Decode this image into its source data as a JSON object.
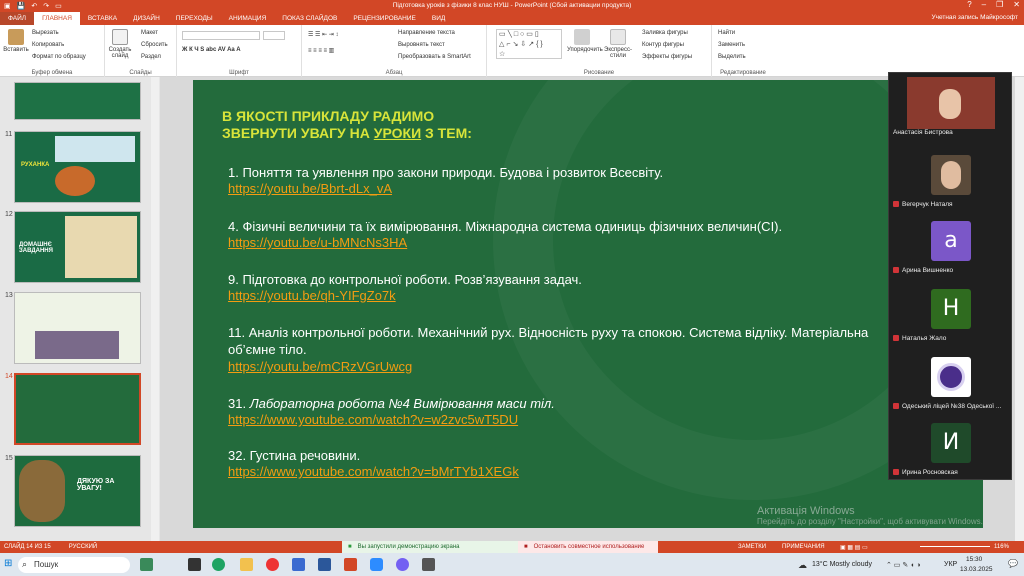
{
  "window": {
    "title": "Підготовка уроків з фізики 8 клас НУШ - PowerPoint (Сбой активации продукта)",
    "account": "Учетная запись Майкрософт"
  },
  "tabs": [
    "ФАЙЛ",
    "ГЛАВНАЯ",
    "ВСТАВКА",
    "ДИЗАЙН",
    "ПЕРЕХОДЫ",
    "АНИМАЦИЯ",
    "ПОКАЗ СЛАЙДОВ",
    "РЕЦЕНЗИРОВАНИЕ",
    "ВИД"
  ],
  "ribbon": {
    "paste": "Вставить",
    "cut": "Вырезать",
    "copy": "Копировать",
    "format": "Формат по образцу",
    "clipboard": "Буфер обмена",
    "new_slide": "Создать слайд",
    "layout": "Макет",
    "reset": "Сбросить",
    "section": "Раздел",
    "slides": "Слайды",
    "font": "Шрифт",
    "paragraph": "Абзац",
    "text_dir": "Направление текста",
    "align_text": "Выровнять текст",
    "smartart": "Преобразовать в SmartArt",
    "arrange": "Упорядочить",
    "quick_styles": "Экспресс-стили",
    "fill": "Заливка фигуры",
    "outline": "Контур фигуры",
    "effects": "Эффекты фигуры",
    "drawing": "Рисование",
    "find": "Найти",
    "replace": "Заменить",
    "select": "Выделить",
    "editing": "Редактирование"
  },
  "thumbnails": [
    {
      "num": "11",
      "title": "РУХАНКА"
    },
    {
      "num": "12",
      "title": "ДОМАШНЄ ЗАВДАННЯ"
    },
    {
      "num": "13",
      "title": ""
    },
    {
      "num": "14",
      "title": ""
    },
    {
      "num": "15",
      "title": "ДЯКУЮ ЗА УВАГУ!"
    }
  ],
  "slide": {
    "heading_line1": "В ЯКОСТІ ПРИКЛАДУ РАДИМО",
    "heading_pre": "ЗВЕРНУТИ УВАГУ НА ",
    "heading_under": "УРОКИ",
    "heading_post": " З ТЕМ:",
    "items": [
      {
        "text": "1.   Поняття та уявлення про закони природи. Будова і розвиток Всесвіту.",
        "link": "https://youtu.be/Bbrt-dLx_vA"
      },
      {
        "text": "4.   Фізичні величини та їх вимірювання. Міжнародна система одиниць фізичних величин(СІ).",
        "link": "https://youtu.be/u-bMNcNs3HA"
      },
      {
        "text": "9. Підготовка до контрольної роботи. Розв’язування задач.",
        "link": "https://youtu.be/qh-YIFgZo7k"
      },
      {
        "text": "11. Аналіз контрольної роботи. Механічний рух. Відносність руху та спокою. Система відліку. Матеріальна",
        "text2": "об’ємне тіло.",
        "link": "https://youtu.be/mCRzVGrUwcg"
      },
      {
        "text_pre": "31. ",
        "text_it": "Лабораторна робота №4 Вимірювання маси тіл.",
        "link": "https://www.youtube.com/watch?v=w2zvc5wT5DU"
      },
      {
        "text": "32. Густина речовини.",
        "link": "https://www.youtube.com/watch?v=bMrTYb1XEGk"
      }
    ],
    "watermark": "Активація Windows",
    "watermark2": "Перейдіть до розділу \"Настройки\", щоб активувати Windows."
  },
  "participants": [
    {
      "name": "Анастасія Бистрова",
      "initial": "",
      "color": "#7a3b2e"
    },
    {
      "name": "Вегерчук Наталя",
      "initial": "",
      "color": "#5a4a3a"
    },
    {
      "name": "Арина Вишненко",
      "initial": "a",
      "color": "#7b57c8"
    },
    {
      "name": "Наталья Жало",
      "initial": "Н",
      "color": "#2f6b1f"
    },
    {
      "name": "Одеський ліцей №38 Одеської ...",
      "initial": "",
      "color": "#ffffff"
    },
    {
      "name": "Ирина Росновская",
      "initial": "И",
      "color": "#1f4a2a"
    }
  ],
  "status": {
    "slide": "СЛАЙД 14 ИЗ 15",
    "lang": "РУССКИЙ",
    "notes": "ЗАМЕТКИ",
    "comments": "ПРИМЕЧАНИЯ",
    "zoom": "116%"
  },
  "share": {
    "running": "Вы запустили демонстрацию экрана",
    "stop": "Остановить совместное использование"
  },
  "taskbar": {
    "search": "Пошук",
    "weather": "13°C  Mostly cloudy",
    "lang": "УКР",
    "time": "15:30",
    "date": "13.03.2025"
  }
}
